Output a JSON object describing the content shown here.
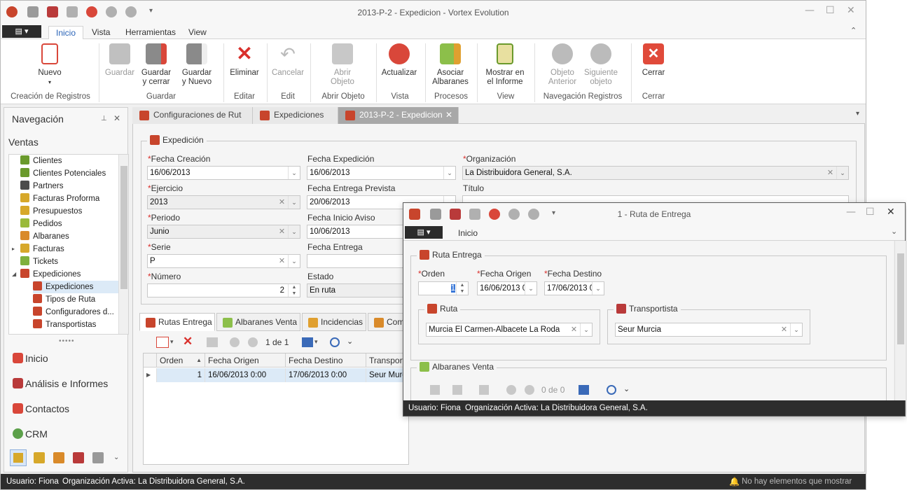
{
  "main_window": {
    "title": "2013-P-2 - Expedicion - Vortex Evolution",
    "menu_tabs": [
      "Inicio",
      "Vista",
      "Herramientas",
      "View"
    ],
    "ribbon": {
      "buttons": {
        "nuevo": "Nuevo",
        "guardar": "Guardar",
        "guardar_cerrar": "Guardar\ny cerrar",
        "guardar_nuevo": "Guardar\ny Nuevo",
        "eliminar": "Eliminar",
        "cancelar": "Cancelar",
        "abrir_objeto": "Abrir\nObjeto",
        "actualizar": "Actualizar",
        "asociar_albaranes": "Asociar\nAlbaranes",
        "mostrar_informe": "Mostrar en\nel Informe",
        "objeto_anterior": "Objeto\nAnterior",
        "siguiente_objeto": "Siguiente\nobjeto",
        "cerrar": "Cerrar"
      },
      "groups": {
        "creacion": "Creación de Registros",
        "guardar": "Guardar",
        "editar": "Editar",
        "edit": "Edit",
        "abrir_objeto": "Abrir Objeto",
        "vista": "Vista",
        "procesos": "Procesos",
        "view": "View",
        "navegacion": "Navegación Registros",
        "cerrar": "Cerrar"
      }
    }
  },
  "navigation": {
    "title": "Navegación",
    "section": "Ventas",
    "items": [
      {
        "label": "Clientes",
        "color": "#6a9a2c"
      },
      {
        "label": "Clientes Potenciales",
        "color": "#6a9a2c"
      },
      {
        "label": "Partners",
        "color": "#4c4c4c"
      },
      {
        "label": "Facturas Proforma",
        "color": "#d7a82a"
      },
      {
        "label": "Presupuestos",
        "color": "#d7a82a"
      },
      {
        "label": "Pedidos",
        "color": "#9aba3a"
      },
      {
        "label": "Albaranes",
        "color": "#d98a2a"
      },
      {
        "label": "Facturas",
        "color": "#d7a82a"
      },
      {
        "label": "Tickets",
        "color": "#7fb03c"
      },
      {
        "label": "Expediciones",
        "color": "#c8452c"
      },
      {
        "label": "Expediciones",
        "color": "#c8452c"
      },
      {
        "label": "Tipos de Ruta",
        "color": "#c8452c"
      },
      {
        "label": "Configuradores d...",
        "color": "#c8452c"
      },
      {
        "label": "Transportistas",
        "color": "#c8452c"
      }
    ],
    "bottom": [
      "Inicio",
      "Análisis e Informes",
      "Contactos",
      "CRM"
    ]
  },
  "doc_tabs": [
    "Configuraciones de Rut",
    "Expediciones",
    "2013-P-2 - Expedicion"
  ],
  "expedicion": {
    "legend": "Expedición",
    "fecha_creacion": {
      "label": "Fecha Creación",
      "value": "16/06/2013"
    },
    "fecha_expedicion": {
      "label": "Fecha Expedición",
      "value": "16/06/2013"
    },
    "organizacion": {
      "label": "Organización",
      "value": "La Distribuidora General, S.A."
    },
    "ejercicio": {
      "label": "Ejercicio",
      "value": "2013"
    },
    "fecha_entrega_prevista": {
      "label": "Fecha Entrega Prevista",
      "value": "20/06/2013"
    },
    "titulo": {
      "label": "Título",
      "value": ""
    },
    "periodo": {
      "label": "Periodo",
      "value": "Junio"
    },
    "fecha_inicio_aviso": {
      "label": "Fecha Inicio Aviso",
      "value": "10/06/2013"
    },
    "serie": {
      "label": "Serie",
      "value": "P"
    },
    "fecha_entrega": {
      "label": "Fecha Entrega",
      "value": ""
    },
    "numero": {
      "label": "Número",
      "value": "2"
    },
    "estado": {
      "label": "Estado",
      "value": "En ruta"
    }
  },
  "sub_tabs": [
    "Rutas Entrega",
    "Albaranes Venta",
    "Incidencias",
    "Com"
  ],
  "grid_toolbar": {
    "page": "1 de 1"
  },
  "grid": {
    "columns": [
      "Orden",
      "Fecha Origen",
      "Fecha Destino",
      "Transporti"
    ],
    "rows": [
      [
        "1",
        "16/06/2013 0:00",
        "17/06/2013 0:00",
        "Seur Murci"
      ]
    ]
  },
  "status": {
    "usuario": "Usuario: Fiona",
    "org": "Organización Activa: La Distribuidora General, S.A.",
    "notif": "No hay elementos que mostrar"
  },
  "popup": {
    "title": "1 - Ruta de Entrega",
    "menu_tab": "Inicio",
    "legend": "Ruta Entrega",
    "orden": {
      "label": "Orden",
      "value": "1"
    },
    "fecha_origen": {
      "label": "Fecha Origen",
      "value": "16/06/2013 0"
    },
    "fecha_destino": {
      "label": "Fecha Destino",
      "value": "17/06/2013 0"
    },
    "ruta": {
      "legend": "Ruta",
      "value": "Murcia El Carmen-Albacete La Roda"
    },
    "transportista": {
      "legend": "Transportista",
      "value": "Seur Murcia"
    },
    "albaranes_legend": "Albaranes Venta",
    "page": "0 de 0",
    "status_user": "Usuario: Fiona",
    "status_org": "Organización Activa: La Distribuidora General, S.A."
  }
}
